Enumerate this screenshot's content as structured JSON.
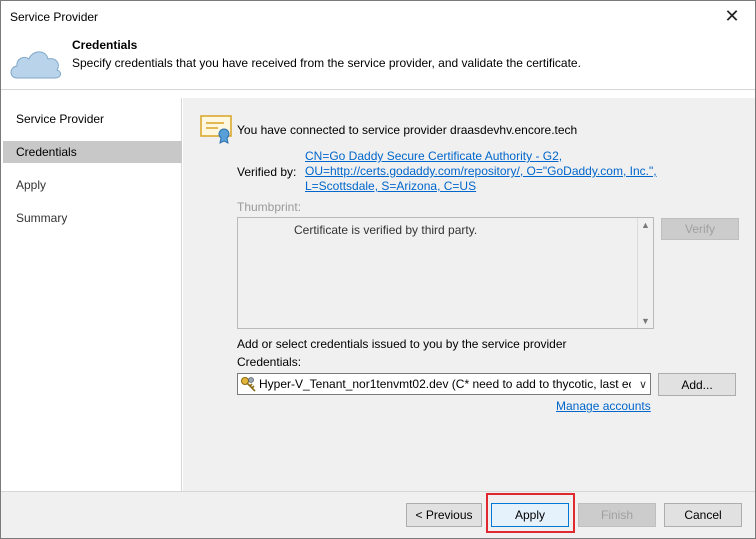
{
  "window": {
    "title": "Service Provider"
  },
  "header": {
    "title": "Credentials",
    "subtitle": "Specify credentials that you have received from the service provider, and validate the certificate."
  },
  "sidebar": {
    "items": [
      {
        "label": "Service Provider"
      },
      {
        "label": "Credentials"
      },
      {
        "label": "Apply"
      },
      {
        "label": "Summary"
      }
    ],
    "active": "Credentials"
  },
  "main": {
    "connected_text": "You have connected to service provider draasdevhv.encore.tech",
    "verified_label": "Verified by:",
    "verified_lines": [
      "CN=Go Daddy Secure Certificate Authority - G2,",
      "OU=http://certs.godaddy.com/repository/, O=\"GoDaddy.com, Inc.\",",
      "L=Scottsdale, S=Arizona, C=US"
    ],
    "thumbprint_label": "Thumbprint:",
    "thumbprint_text": "Certificate is verified by third party.",
    "verify_label": "Verify",
    "add_select_text": "Add or select credentials issued to you by the service provider",
    "credentials_label": "Credentials:",
    "credentials_value": "Hyper-V_Tenant_nor1tenvmt02.dev (C* need to add to thycotic, last ec",
    "add_button": "Add...",
    "manage_link": "Manage accounts"
  },
  "footer": {
    "previous": "< Previous",
    "apply": "Apply",
    "finish": "Finish",
    "cancel": "Cancel"
  },
  "colors": {
    "link": "#0066cc",
    "highlight": "#e0282f",
    "active_sidebar": "#c8c8c8",
    "cloud": "#b8d3ea"
  }
}
